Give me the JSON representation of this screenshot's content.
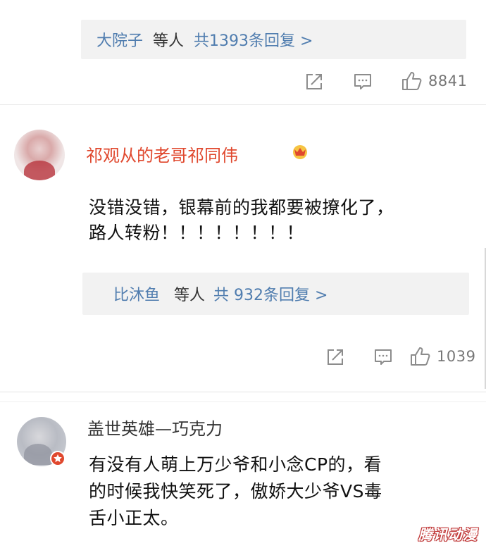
{
  "thread1": {
    "reply_user": "大院子",
    "reply_etc": "等人",
    "reply_count": "共1393条回复 >",
    "likes": "8841"
  },
  "comment2": {
    "username": "祁观从的老哥祁同伟",
    "text_line1": "没错没错，银幕前的我都要被撩化了，",
    "text_line2": "路人转粉！！！！！！！！",
    "reply_user": "比沐鱼",
    "reply_etc": "等人",
    "reply_count": "共 932条回复 >",
    "likes": "1039"
  },
  "comment3": {
    "username": "盖世英雄—巧克力",
    "text_line1": "有没有人萌上万少爷和小念CP的，看",
    "text_line2": "的时候我快笑死了，傲娇大少爷VS毒",
    "text_line3": "舌小正太。"
  },
  "watermark": "腾讯动漫",
  "colors": {
    "link_blue": "#507daf",
    "vip_red": "#e0482e",
    "reply_bg": "#f2f2f2",
    "icon_gray": "#8c8c8c"
  },
  "icons": [
    "share-icon",
    "comment-icon",
    "like-icon",
    "crown-icon",
    "badge-icon"
  ]
}
